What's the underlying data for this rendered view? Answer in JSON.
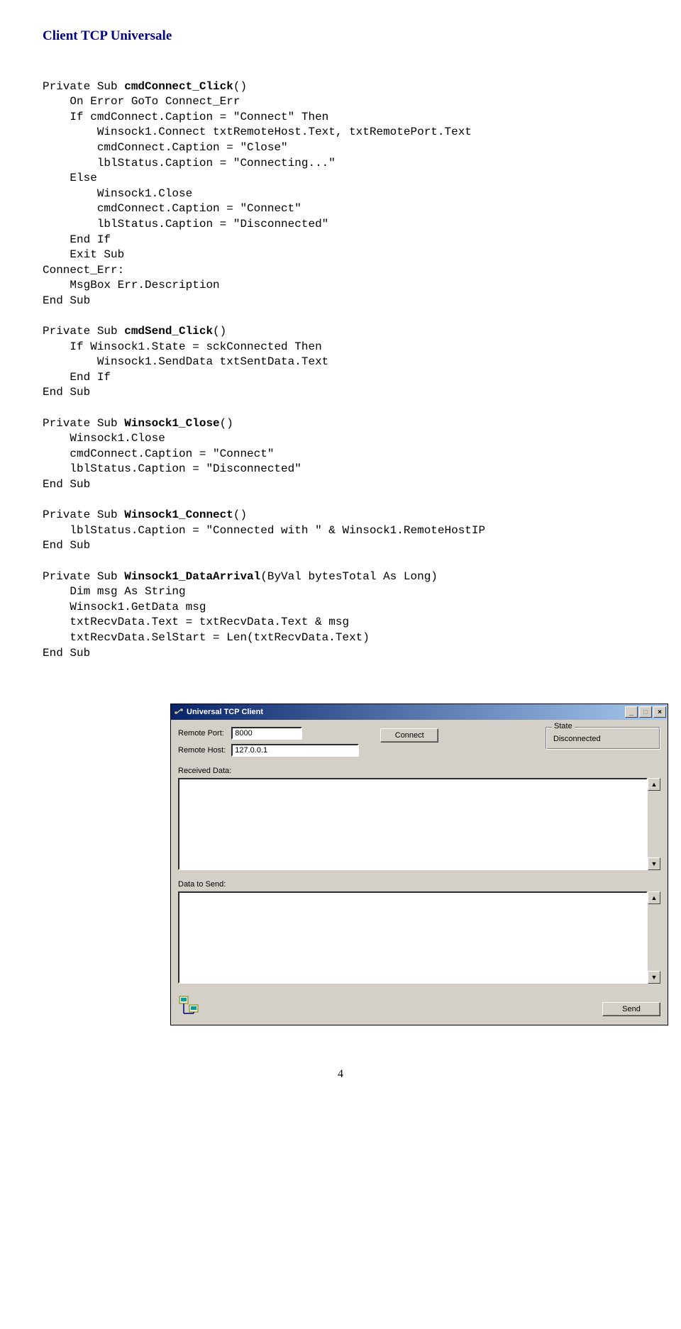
{
  "title": "Client TCP Universale",
  "code_lines": [
    {
      "i": 0,
      "t": ""
    },
    {
      "i": 0,
      "t": "Private Sub ",
      "b": "cmdConnect_Click",
      "t2": "()"
    },
    {
      "i": 1,
      "t": "On Error GoTo Connect_Err"
    },
    {
      "i": 1,
      "t": "If cmdConnect.Caption = \"Connect\" Then"
    },
    {
      "i": 2,
      "t": "Winsock1.Connect txtRemoteHost.Text, txtRemotePort.Text"
    },
    {
      "i": 2,
      "t": "cmdConnect.Caption = \"Close\""
    },
    {
      "i": 2,
      "t": "lblStatus.Caption = \"Connecting...\""
    },
    {
      "i": 1,
      "t": "Else"
    },
    {
      "i": 2,
      "t": "Winsock1.Close"
    },
    {
      "i": 2,
      "t": "cmdConnect.Caption = \"Connect\""
    },
    {
      "i": 2,
      "t": "lblStatus.Caption = \"Disconnected\""
    },
    {
      "i": 1,
      "t": "End If"
    },
    {
      "i": 1,
      "t": "Exit Sub"
    },
    {
      "i": 0,
      "t": "Connect_Err:"
    },
    {
      "i": 1,
      "t": "MsgBox Err.Description"
    },
    {
      "i": 0,
      "t": "End Sub"
    },
    {
      "i": 0,
      "t": ""
    },
    {
      "i": 0,
      "t": "Private Sub ",
      "b": "cmdSend_Click",
      "t2": "()"
    },
    {
      "i": 1,
      "t": "If Winsock1.State = sckConnected Then"
    },
    {
      "i": 2,
      "t": "Winsock1.SendData txtSentData.Text"
    },
    {
      "i": 1,
      "t": "End If"
    },
    {
      "i": 0,
      "t": "End Sub"
    },
    {
      "i": 0,
      "t": ""
    },
    {
      "i": 0,
      "t": "Private Sub ",
      "b": "Winsock1_Close",
      "t2": "()"
    },
    {
      "i": 1,
      "t": "Winsock1.Close"
    },
    {
      "i": 1,
      "t": "cmdConnect.Caption = \"Connect\""
    },
    {
      "i": 1,
      "t": "lblStatus.Caption = \"Disconnected\""
    },
    {
      "i": 0,
      "t": "End Sub"
    },
    {
      "i": 0,
      "t": ""
    },
    {
      "i": 0,
      "t": "Private Sub ",
      "b": "Winsock1_Connect",
      "t2": "()"
    },
    {
      "i": 1,
      "t": "lblStatus.Caption = \"Connected with \" & Winsock1.RemoteHostIP"
    },
    {
      "i": 0,
      "t": "End Sub"
    },
    {
      "i": 0,
      "t": ""
    },
    {
      "i": 0,
      "t": "Private Sub ",
      "b": "Winsock1_DataArrival",
      "t2": "(ByVal bytesTotal As Long)"
    },
    {
      "i": 1,
      "t": "Dim msg As String"
    },
    {
      "i": 1,
      "t": "Winsock1.GetData msg"
    },
    {
      "i": 1,
      "t": "txtRecvData.Text = txtRecvData.Text & msg"
    },
    {
      "i": 1,
      "t": "txtRecvData.SelStart = Len(txtRecvData.Text)"
    },
    {
      "i": 0,
      "t": "End Sub"
    }
  ],
  "window": {
    "title": "Universal TCP Client",
    "remote_port_label": "Remote Port:",
    "remote_port_value": "8000",
    "remote_host_label": "Remote Host:",
    "remote_host_value": "127.0.0.1",
    "connect_label": "Connect",
    "state_group": "State",
    "state_value": "Disconnected",
    "received_label": "Received Data:",
    "send_label": "Data to Send:",
    "send_button": "Send"
  },
  "page_number": "4"
}
